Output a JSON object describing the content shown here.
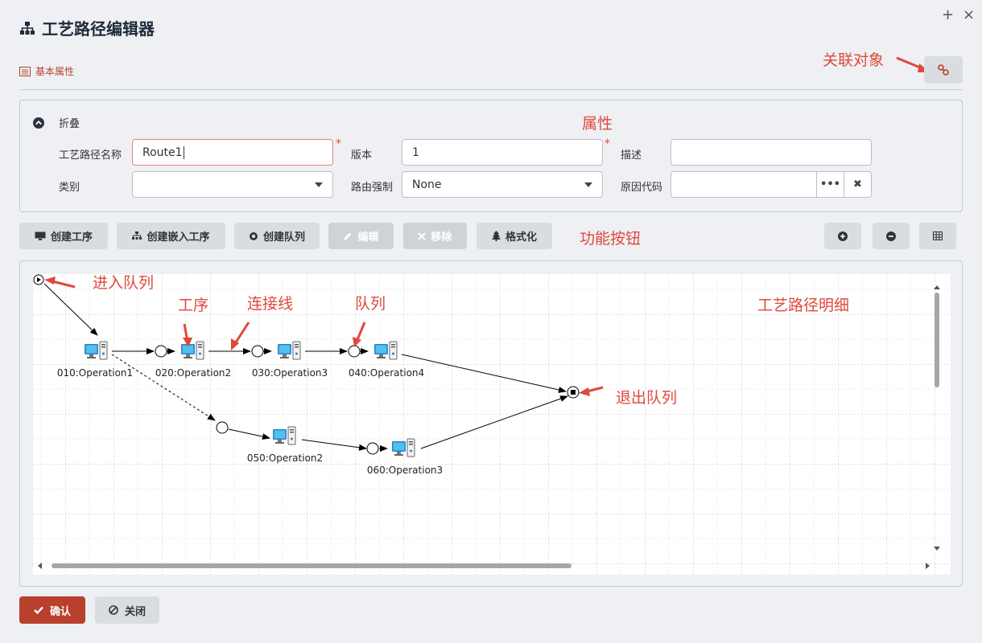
{
  "window": {
    "title": "工艺路径编辑器",
    "maximize_glyph": "+",
    "close_glyph": "×"
  },
  "tabs": {
    "basic_props": "基本属性"
  },
  "annotations": {
    "related_object": "关联对象",
    "properties": "属性",
    "function_buttons": "功能按钮",
    "enter_queue": "进入队列",
    "operation": "工序",
    "connector": "连接线",
    "queue": "队列",
    "route_detail": "工艺路径明细",
    "exit_queue": "退出队列"
  },
  "props": {
    "collapse_label": "折叠",
    "route_name_label": "工艺路径名称",
    "route_name_value": "Route1",
    "version_label": "版本",
    "version_value": "1",
    "description_label": "描述",
    "description_value": "",
    "category_label": "类别",
    "category_value": "",
    "routing_force_label": "路由强制",
    "routing_force_value": "None",
    "reason_code_label": "原因代码",
    "reason_code_value": "",
    "more_glyph": "•••",
    "clear_glyph": "✖",
    "required_mark": "*"
  },
  "toolbar": {
    "create_operation": "创建工序",
    "create_embedded": "创建嵌入工序",
    "create_queue": "创建队列",
    "edit": "编辑",
    "remove": "移除",
    "format": "格式化"
  },
  "diagram": {
    "operations": [
      {
        "label": "010:Operation1"
      },
      {
        "label": "020:Operation2"
      },
      {
        "label": "030:Operation3"
      },
      {
        "label": "040:Operation4"
      },
      {
        "label": "050:Operation2"
      },
      {
        "label": "060:Operation3"
      }
    ]
  },
  "footer": {
    "confirm": "确认",
    "close": "关闭"
  },
  "colors": {
    "accent": "#b9402c",
    "annotation": "#e0483a",
    "title": "#1f2a3a"
  }
}
